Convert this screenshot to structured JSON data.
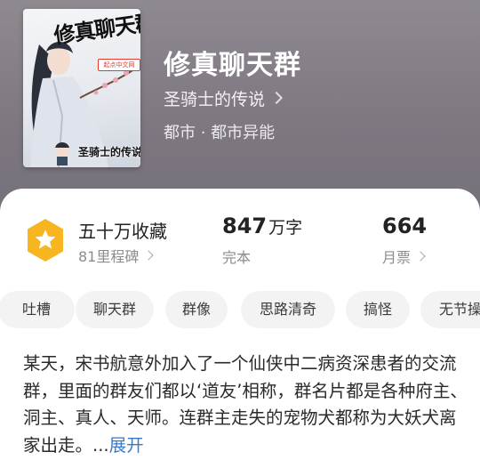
{
  "book": {
    "cover_title": "修真聊天群",
    "cover_badge": "起点中文网",
    "cover_author": "圣骑士的传说",
    "title": "修真聊天群",
    "author": "圣骑士的传说",
    "category": "都市 · 都市异能"
  },
  "stats": {
    "favorites": "五十万收藏",
    "milestones": "81里程碑",
    "word_count_num": "847",
    "word_count_unit": "万字",
    "status": "完本",
    "monthly_votes": "664",
    "monthly_votes_label": "月票",
    "star_icon_color": "#f7b520"
  },
  "tags": [
    "吐槽",
    "聊天群",
    "群像",
    "思路清奇",
    "搞怪",
    "无节操"
  ],
  "description": {
    "text": "某天，宋书航意外加入了一个仙侠中二病资深患者的交流群，里面的群友们都以‘道友’相称，群名片都是各种府主、洞主、真人、天师。连群主走失的宠物犬都称为大妖犬离家出走。...",
    "expand_label": "展开",
    "link_color": "#3d78c7"
  }
}
